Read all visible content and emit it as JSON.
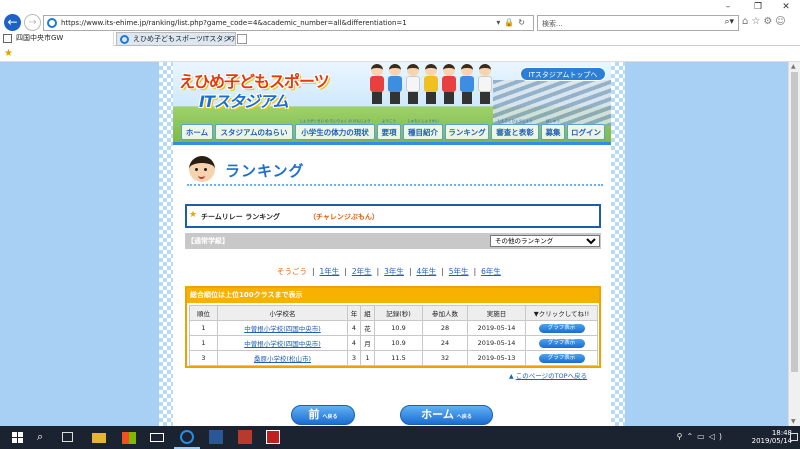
{
  "browser": {
    "url": "https://www.its-ehime.jp/ranking/list.php?game_code=4&academic_number=all&differentiation=1",
    "search_placeholder": "検索...",
    "tabs": [
      {
        "label": "四国中央市GW"
      },
      {
        "label": "えひめ子どもスポーツITスタジア..."
      }
    ]
  },
  "site": {
    "logo_line1": "えひめ子どもスポーツ",
    "logo_line2": "ITスタジアム",
    "top_link": "ITスタジアムトップへ",
    "nav": [
      {
        "label": "ホーム",
        "ruby": ""
      },
      {
        "label": "スタジアムのねらい",
        "ruby": ""
      },
      {
        "label": "小学生の体力の現状",
        "ruby": "しょうがくせい の たいりょく の げんじょう"
      },
      {
        "label": "要項",
        "ruby": "ようこう"
      },
      {
        "label": "種目紹介",
        "ruby": "しゅもくしょうかい"
      },
      {
        "label": "ランキング",
        "ruby": ""
      },
      {
        "label": "審査と表彰",
        "ruby": "しんさとひょうしょう"
      },
      {
        "label": "募集",
        "ruby": "ぼしゅう"
      },
      {
        "label": "ログイン",
        "ruby": ""
      }
    ]
  },
  "page": {
    "heading": "ランキング",
    "event_name": "チームリレー ランキング",
    "event_kind": "（チャレンジぶもん）",
    "section_label": "【通常学級】",
    "other_ranking_option": "その他のランキング",
    "grades": [
      "そうごう",
      "1年生",
      "2年生",
      "3年生",
      "4年生",
      "5年生",
      "6年生"
    ],
    "grades_active_index": 0,
    "table_header_note": "総合順位は上位100クラスまで表示",
    "columns": [
      "順位",
      "小学校名",
      "年",
      "組",
      "記録(秒)",
      "参加人数",
      "実施日",
      "▼クリックしてね!!"
    ],
    "rows": [
      {
        "rank": "1",
        "school": "中曽根小学校(四国中央市)",
        "year": "4",
        "class": "花",
        "record": "10.9",
        "participants": "28",
        "date": "2019-05-14",
        "button": "グラフ表示"
      },
      {
        "rank": "1",
        "school": "中曽根小学校(四国中央市)",
        "year": "4",
        "class": "月",
        "record": "10.9",
        "participants": "24",
        "date": "2019-05-14",
        "button": "グラフ表示"
      },
      {
        "rank": "3",
        "school": "桑原小学校(松山市)",
        "year": "3",
        "class": "1",
        "record": "11.5",
        "participants": "32",
        "date": "2019-05-13",
        "button": "グラフ表示"
      }
    ],
    "page_top_link": "このページのTOPへ戻る",
    "prev_button": "前",
    "prev_button_small": "へ戻る",
    "home_button": "ホーム",
    "home_button_small": "へ戻る"
  },
  "taskbar": {
    "time": "18:48",
    "date": "2019/05/14"
  }
}
